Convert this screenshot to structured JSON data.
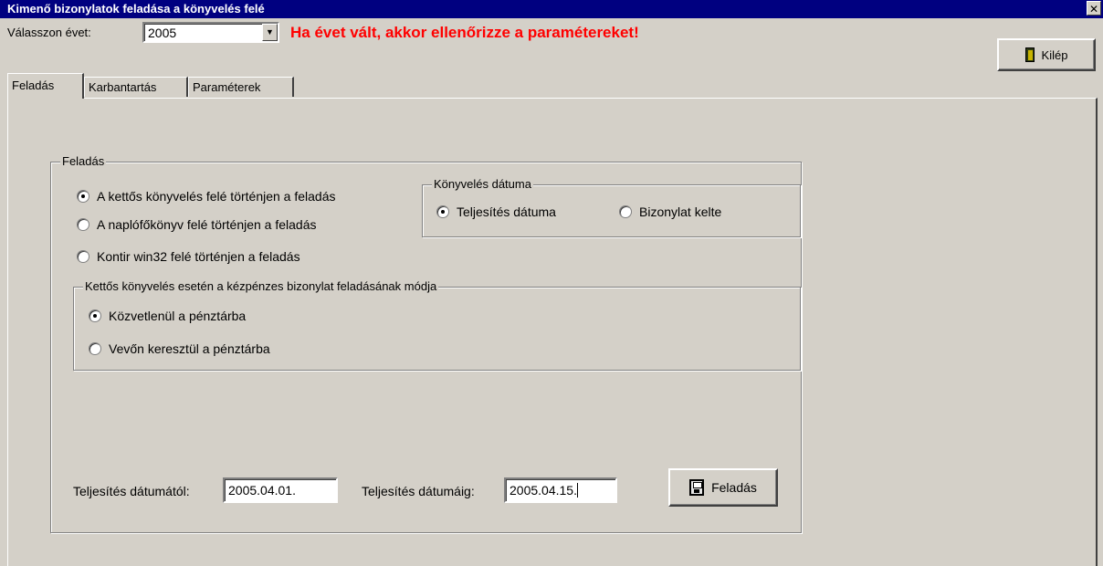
{
  "window": {
    "title": "Kimenő bizonylatok feladása a könyvelés felé",
    "close_symbol": "✕"
  },
  "toolbar": {
    "year_label": "Válasszon évet:",
    "year_value": "2005",
    "dropdown_arrow": "▼",
    "warning": "Ha évet vált, akkor ellenőrizze a paramétereket!",
    "exit_label": "Kilép"
  },
  "tabs": [
    {
      "label": "Feladás",
      "active": true
    },
    {
      "label": "Karbantartás",
      "active": false
    },
    {
      "label": "Paraméterek",
      "active": false
    }
  ],
  "feladas_group": {
    "title": "Feladás",
    "options": [
      {
        "label": "A kettős könyvelés felé történjen a feladás",
        "checked": true
      },
      {
        "label": "A naplófőkönyv felé történjen a feladás",
        "checked": false
      },
      {
        "label": "Kontir win32 felé történjen a feladás",
        "checked": false
      }
    ]
  },
  "datum_group": {
    "title": "Könyvelés dátuma",
    "options": [
      {
        "label": "Teljesítés dátuma",
        "checked": true
      },
      {
        "label": "Bizonylat kelte",
        "checked": false
      }
    ]
  },
  "kettos_group": {
    "title": "Kettős könyvelés esetén a kézpénzes bizonylat feladásának módja",
    "options": [
      {
        "label": "Közvetlenül a pénztárba",
        "checked": true
      },
      {
        "label": "Vevőn keresztül a pénztárba",
        "checked": false
      }
    ]
  },
  "dates": {
    "from_label": "Teljesítés dátumától:",
    "from_value": "2005.04.01.",
    "to_label": "Teljesítés dátumáig:",
    "to_value": "2005.04.15."
  },
  "send_button": {
    "label": "Feladás"
  },
  "icons": {
    "exit": "door-icon",
    "send": "floppy-disk-icon",
    "close": "close-icon",
    "dropdown": "chevron-down-icon"
  },
  "colors": {
    "titlebar": "#000080",
    "warning": "#ff0000",
    "face": "#d4d0c8"
  }
}
